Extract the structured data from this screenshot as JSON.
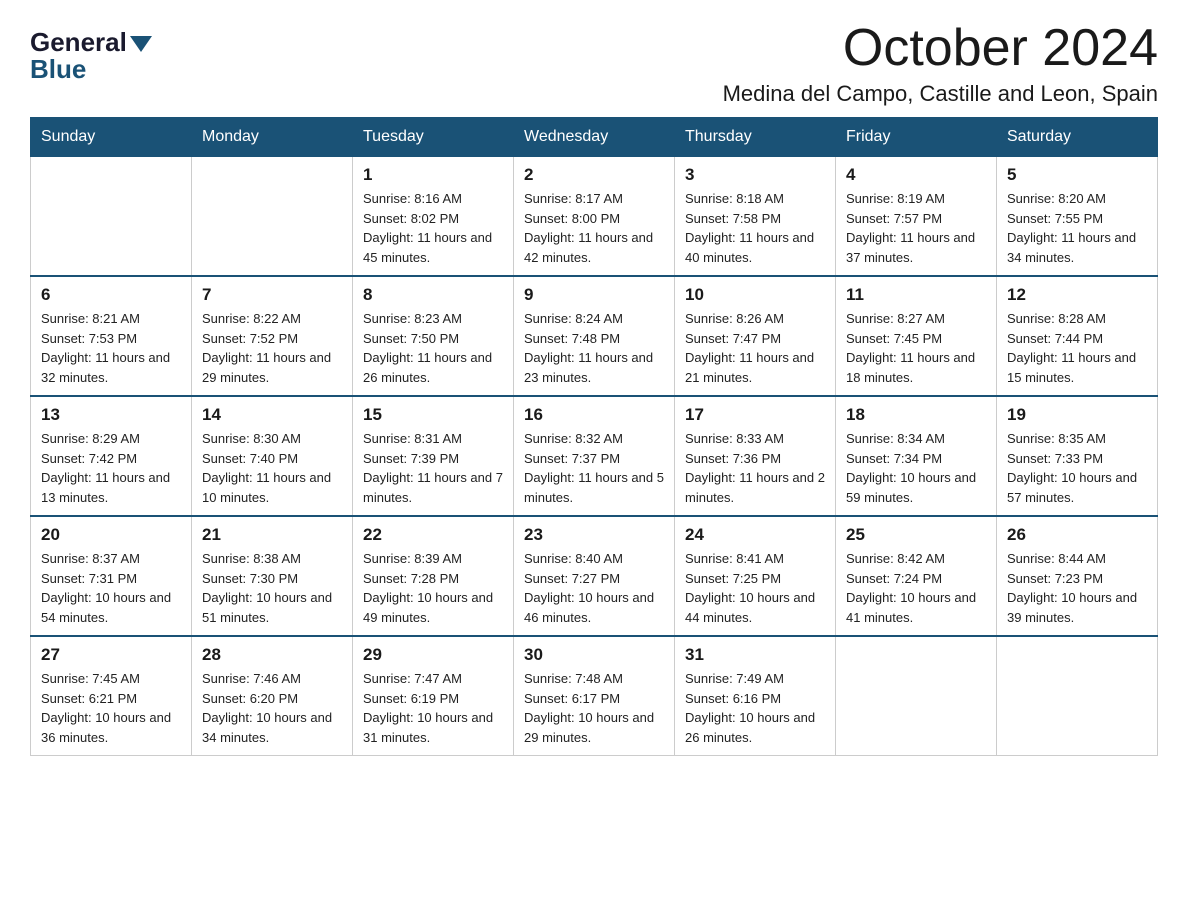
{
  "logo": {
    "general": "General",
    "blue": "Blue",
    "arrow": "▼"
  },
  "title": "October 2024",
  "location": "Medina del Campo, Castille and Leon, Spain",
  "headers": [
    "Sunday",
    "Monday",
    "Tuesday",
    "Wednesday",
    "Thursday",
    "Friday",
    "Saturday"
  ],
  "weeks": [
    [
      {
        "day": "",
        "sunrise": "",
        "sunset": "",
        "daylight": ""
      },
      {
        "day": "",
        "sunrise": "",
        "sunset": "",
        "daylight": ""
      },
      {
        "day": "1",
        "sunrise": "Sunrise: 8:16 AM",
        "sunset": "Sunset: 8:02 PM",
        "daylight": "Daylight: 11 hours and 45 minutes."
      },
      {
        "day": "2",
        "sunrise": "Sunrise: 8:17 AM",
        "sunset": "Sunset: 8:00 PM",
        "daylight": "Daylight: 11 hours and 42 minutes."
      },
      {
        "day": "3",
        "sunrise": "Sunrise: 8:18 AM",
        "sunset": "Sunset: 7:58 PM",
        "daylight": "Daylight: 11 hours and 40 minutes."
      },
      {
        "day": "4",
        "sunrise": "Sunrise: 8:19 AM",
        "sunset": "Sunset: 7:57 PM",
        "daylight": "Daylight: 11 hours and 37 minutes."
      },
      {
        "day": "5",
        "sunrise": "Sunrise: 8:20 AM",
        "sunset": "Sunset: 7:55 PM",
        "daylight": "Daylight: 11 hours and 34 minutes."
      }
    ],
    [
      {
        "day": "6",
        "sunrise": "Sunrise: 8:21 AM",
        "sunset": "Sunset: 7:53 PM",
        "daylight": "Daylight: 11 hours and 32 minutes."
      },
      {
        "day": "7",
        "sunrise": "Sunrise: 8:22 AM",
        "sunset": "Sunset: 7:52 PM",
        "daylight": "Daylight: 11 hours and 29 minutes."
      },
      {
        "day": "8",
        "sunrise": "Sunrise: 8:23 AM",
        "sunset": "Sunset: 7:50 PM",
        "daylight": "Daylight: 11 hours and 26 minutes."
      },
      {
        "day": "9",
        "sunrise": "Sunrise: 8:24 AM",
        "sunset": "Sunset: 7:48 PM",
        "daylight": "Daylight: 11 hours and 23 minutes."
      },
      {
        "day": "10",
        "sunrise": "Sunrise: 8:26 AM",
        "sunset": "Sunset: 7:47 PM",
        "daylight": "Daylight: 11 hours and 21 minutes."
      },
      {
        "day": "11",
        "sunrise": "Sunrise: 8:27 AM",
        "sunset": "Sunset: 7:45 PM",
        "daylight": "Daylight: 11 hours and 18 minutes."
      },
      {
        "day": "12",
        "sunrise": "Sunrise: 8:28 AM",
        "sunset": "Sunset: 7:44 PM",
        "daylight": "Daylight: 11 hours and 15 minutes."
      }
    ],
    [
      {
        "day": "13",
        "sunrise": "Sunrise: 8:29 AM",
        "sunset": "Sunset: 7:42 PM",
        "daylight": "Daylight: 11 hours and 13 minutes."
      },
      {
        "day": "14",
        "sunrise": "Sunrise: 8:30 AM",
        "sunset": "Sunset: 7:40 PM",
        "daylight": "Daylight: 11 hours and 10 minutes."
      },
      {
        "day": "15",
        "sunrise": "Sunrise: 8:31 AM",
        "sunset": "Sunset: 7:39 PM",
        "daylight": "Daylight: 11 hours and 7 minutes."
      },
      {
        "day": "16",
        "sunrise": "Sunrise: 8:32 AM",
        "sunset": "Sunset: 7:37 PM",
        "daylight": "Daylight: 11 hours and 5 minutes."
      },
      {
        "day": "17",
        "sunrise": "Sunrise: 8:33 AM",
        "sunset": "Sunset: 7:36 PM",
        "daylight": "Daylight: 11 hours and 2 minutes."
      },
      {
        "day": "18",
        "sunrise": "Sunrise: 8:34 AM",
        "sunset": "Sunset: 7:34 PM",
        "daylight": "Daylight: 10 hours and 59 minutes."
      },
      {
        "day": "19",
        "sunrise": "Sunrise: 8:35 AM",
        "sunset": "Sunset: 7:33 PM",
        "daylight": "Daylight: 10 hours and 57 minutes."
      }
    ],
    [
      {
        "day": "20",
        "sunrise": "Sunrise: 8:37 AM",
        "sunset": "Sunset: 7:31 PM",
        "daylight": "Daylight: 10 hours and 54 minutes."
      },
      {
        "day": "21",
        "sunrise": "Sunrise: 8:38 AM",
        "sunset": "Sunset: 7:30 PM",
        "daylight": "Daylight: 10 hours and 51 minutes."
      },
      {
        "day": "22",
        "sunrise": "Sunrise: 8:39 AM",
        "sunset": "Sunset: 7:28 PM",
        "daylight": "Daylight: 10 hours and 49 minutes."
      },
      {
        "day": "23",
        "sunrise": "Sunrise: 8:40 AM",
        "sunset": "Sunset: 7:27 PM",
        "daylight": "Daylight: 10 hours and 46 minutes."
      },
      {
        "day": "24",
        "sunrise": "Sunrise: 8:41 AM",
        "sunset": "Sunset: 7:25 PM",
        "daylight": "Daylight: 10 hours and 44 minutes."
      },
      {
        "day": "25",
        "sunrise": "Sunrise: 8:42 AM",
        "sunset": "Sunset: 7:24 PM",
        "daylight": "Daylight: 10 hours and 41 minutes."
      },
      {
        "day": "26",
        "sunrise": "Sunrise: 8:44 AM",
        "sunset": "Sunset: 7:23 PM",
        "daylight": "Daylight: 10 hours and 39 minutes."
      }
    ],
    [
      {
        "day": "27",
        "sunrise": "Sunrise: 7:45 AM",
        "sunset": "Sunset: 6:21 PM",
        "daylight": "Daylight: 10 hours and 36 minutes."
      },
      {
        "day": "28",
        "sunrise": "Sunrise: 7:46 AM",
        "sunset": "Sunset: 6:20 PM",
        "daylight": "Daylight: 10 hours and 34 minutes."
      },
      {
        "day": "29",
        "sunrise": "Sunrise: 7:47 AM",
        "sunset": "Sunset: 6:19 PM",
        "daylight": "Daylight: 10 hours and 31 minutes."
      },
      {
        "day": "30",
        "sunrise": "Sunrise: 7:48 AM",
        "sunset": "Sunset: 6:17 PM",
        "daylight": "Daylight: 10 hours and 29 minutes."
      },
      {
        "day": "31",
        "sunrise": "Sunrise: 7:49 AM",
        "sunset": "Sunset: 6:16 PM",
        "daylight": "Daylight: 10 hours and 26 minutes."
      },
      {
        "day": "",
        "sunrise": "",
        "sunset": "",
        "daylight": ""
      },
      {
        "day": "",
        "sunrise": "",
        "sunset": "",
        "daylight": ""
      }
    ]
  ]
}
